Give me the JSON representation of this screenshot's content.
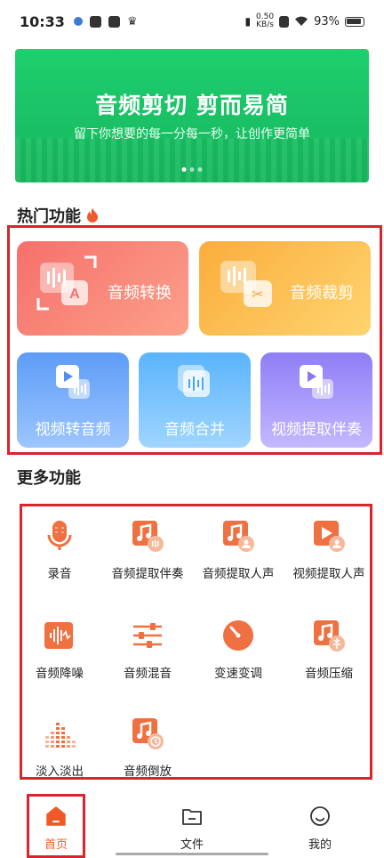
{
  "status_bar": {
    "time": "10:33",
    "net_speed_value": "0.50",
    "net_speed_unit": "KB/s",
    "battery": "93%"
  },
  "banner": {
    "title": "音频剪切 剪而易简",
    "subtitle": "留下你想要的每一分每一秒，让创作更简单",
    "page_count": 3,
    "active_page": 1
  },
  "hot": {
    "title": "热门功能",
    "cards": [
      {
        "label": "音频转换",
        "icon": "audio-convert-icon"
      },
      {
        "label": "音频裁剪",
        "icon": "audio-cut-icon"
      },
      {
        "label": "视频转音频",
        "icon": "video-to-audio-icon"
      },
      {
        "label": "音频合并",
        "icon": "audio-merge-icon"
      },
      {
        "label": "视频提取伴奏",
        "icon": "video-extract-accompaniment-icon"
      }
    ]
  },
  "more": {
    "title": "更多功能",
    "items": [
      {
        "label": "录音",
        "icon": "microphone-icon"
      },
      {
        "label": "音频提取伴奏",
        "icon": "audio-extract-accompaniment-icon"
      },
      {
        "label": "音频提取人声",
        "icon": "audio-extract-vocal-icon"
      },
      {
        "label": "视频提取人声",
        "icon": "video-extract-vocal-icon"
      },
      {
        "label": "音频降噪",
        "icon": "noise-reduction-icon"
      },
      {
        "label": "音频混音",
        "icon": "mixer-icon"
      },
      {
        "label": "变速变调",
        "icon": "speed-pitch-icon"
      },
      {
        "label": "音频压缩",
        "icon": "audio-compress-icon"
      },
      {
        "label": "淡入淡出",
        "icon": "fade-icon"
      },
      {
        "label": "音频倒放",
        "icon": "audio-reverse-icon"
      }
    ]
  },
  "nav": {
    "items": [
      {
        "label": "首页",
        "icon": "home-icon",
        "active": true
      },
      {
        "label": "文件",
        "icon": "folder-icon",
        "active": false
      },
      {
        "label": "我的",
        "icon": "profile-icon",
        "active": false
      }
    ]
  },
  "colors": {
    "banner_green": "#1fcf6e",
    "accent_orange": "#f05a28",
    "highlight_red": "#d9232d"
  }
}
